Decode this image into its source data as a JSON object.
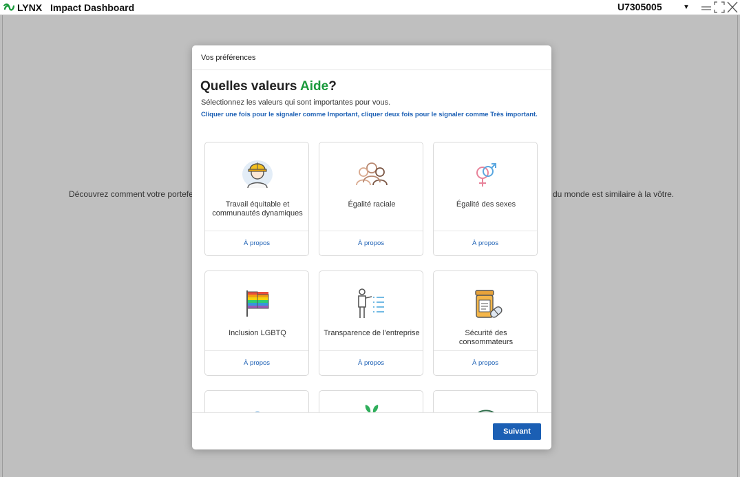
{
  "titlebar": {
    "brand": "LYNX",
    "app_title": "Impact Dashboard",
    "account": "U7305005"
  },
  "background": {
    "text_left": "Découvrez comment votre portefe",
    "text_right": "du monde est similaire à la vôtre."
  },
  "modal": {
    "header_title": "Vos préférences",
    "heading_prefix": "Quelles valeurs ",
    "heading_accent": "Aide",
    "heading_suffix": "?",
    "subtitle": "Sélectionnez les valeurs qui sont importantes pour vous.",
    "instruction": "Cliquer une fois pour le signaler comme Important, cliquer deux fois pour le signaler comme Très important.",
    "cards": [
      {
        "label": "Travail équitable et communautés dynamiques",
        "about": "À propos",
        "icon": "worker-helmet-icon"
      },
      {
        "label": "Égalité raciale",
        "about": "À propos",
        "icon": "people-group-icon"
      },
      {
        "label": "Égalité des sexes",
        "about": "À propos",
        "icon": "gender-symbols-icon"
      },
      {
        "label": "Inclusion LGBTQ",
        "about": "À propos",
        "icon": "rainbow-flag-icon"
      },
      {
        "label": "Transparence de l'entreprise",
        "about": "À propos",
        "icon": "presenter-list-icon"
      },
      {
        "label": "Sécurité des consommateurs",
        "about": "À propos",
        "icon": "pill-bottle-icon"
      }
    ],
    "next_button": "Suivant"
  },
  "colors": {
    "accent_green": "#1a9a3c",
    "link_blue": "#1b5fb4",
    "overlay_gray": "#bfbfbf"
  }
}
